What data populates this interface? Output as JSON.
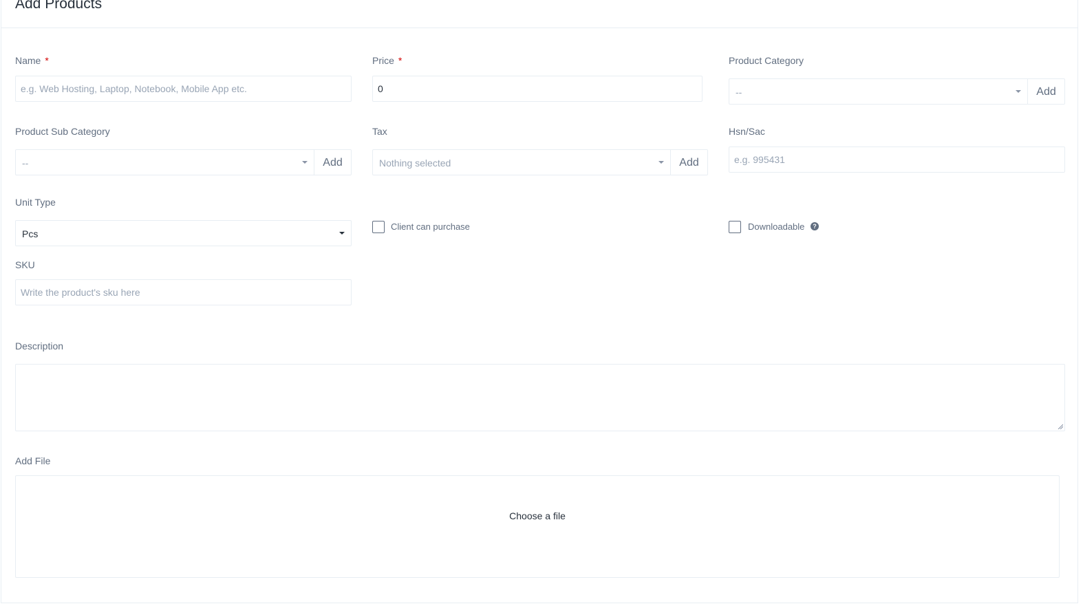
{
  "header": {
    "title": "Add Products"
  },
  "fields": {
    "name": {
      "label": "Name",
      "required": "*",
      "placeholder": "e.g. Web Hosting, Laptop, Notebook, Mobile App etc."
    },
    "price": {
      "label": "Price",
      "required": "*",
      "value": "0"
    },
    "product_category": {
      "label": "Product Category",
      "value": "--",
      "add_label": "Add"
    },
    "product_sub_category": {
      "label": "Product Sub Category",
      "value": "--",
      "add_label": "Add"
    },
    "tax": {
      "label": "Tax",
      "value": "Nothing selected",
      "add_label": "Add"
    },
    "hsn_sac": {
      "label": "Hsn/Sac",
      "placeholder": "e.g. 995431"
    },
    "unit_type": {
      "label": "Unit Type",
      "value": "Pcs"
    },
    "client_can_purchase": {
      "label": "Client can purchase"
    },
    "downloadable": {
      "label": "Downloadable",
      "help_icon": "?"
    },
    "sku": {
      "label": "SKU",
      "placeholder": "Write the product's sku here"
    },
    "description": {
      "label": "Description"
    },
    "add_file": {
      "label": "Add File",
      "choose_text": "Choose a file"
    }
  },
  "icons": {
    "help": "question-circle-icon",
    "caret": "caret-down-icon"
  },
  "colors": {
    "required": "#d30000",
    "border": "#e8eef3",
    "label": "#616e80"
  }
}
